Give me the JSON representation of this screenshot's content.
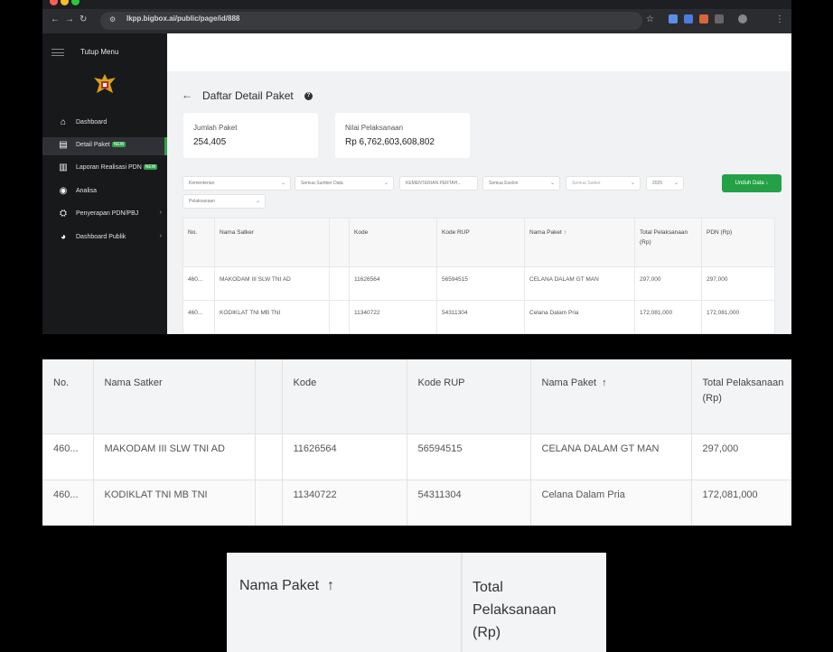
{
  "browser": {
    "url": "lkpp.bigbox.ai/public/page/id/888",
    "colors": {
      "frame": "#2b2c30",
      "dot_red": "#ff5f57",
      "dot_yellow": "#febc2e",
      "dot_green": "#28c840"
    }
  },
  "sidebar": {
    "toggle_label": "Tutup Menu",
    "items": [
      {
        "label": "Dashboard",
        "icon": "home-icon"
      },
      {
        "label": "Detail Paket",
        "badge": "NEW",
        "icon": "document-icon",
        "active": true
      },
      {
        "label": "Laporan Realisasi PDN",
        "badge": "NEW",
        "icon": "building-icon"
      },
      {
        "label": "Analisa",
        "icon": "analysis-icon"
      },
      {
        "label": "Penyerapan PDN/PBJ",
        "icon": "basket-icon",
        "chevron": "›"
      },
      {
        "label": "Dashboard Publik",
        "icon": "pie-chart-icon",
        "chevron": "›"
      }
    ],
    "accent": "#2ea24a"
  },
  "page": {
    "back": "←",
    "title": "Daftar Detail Paket",
    "help": "?"
  },
  "stats": [
    {
      "label": "Jumlah Paket",
      "value": "254,405"
    },
    {
      "label": "Nilai Pelaksanaan",
      "value": "Rp 6,762,603,608,802"
    }
  ],
  "filters": {
    "kementerian": "Kementerian",
    "sumber_data": "Semua Sumber Data",
    "kementerian_pertahanan": "KEMENTERIAN PERTAH...",
    "eselon": "Semua Eselon",
    "satker": "Semua Satker",
    "tahun": "2025",
    "pelaksanaan": "Pelaksanaan",
    "download": "Unduh Data ↓"
  },
  "table": {
    "headers": [
      "No.",
      "Nama Satker",
      "",
      "Kode",
      "Kode RUP",
      "Nama Paket",
      "Total Pelaksanaan (Rp)",
      "PDN (Rp)"
    ],
    "sort_icon": "↑",
    "rows": [
      [
        "460...",
        "MAKODAM III SLW TNI AD",
        "",
        "11626564",
        "56594515",
        "CELANA DALAM GT MAN",
        "297,000",
        "297,000"
      ],
      [
        "460...",
        "KODIKLAT TNI MB TNI",
        "",
        "11340722",
        "54311304",
        "Celana Dalam Pria",
        "172,081,000",
        "172,081,000"
      ]
    ]
  },
  "zoom": {
    "nama_paket": "Nama Paket",
    "sort_icon": "↑",
    "total_pelaksanaan": "Total Pelaksanaan (Rp)"
  }
}
